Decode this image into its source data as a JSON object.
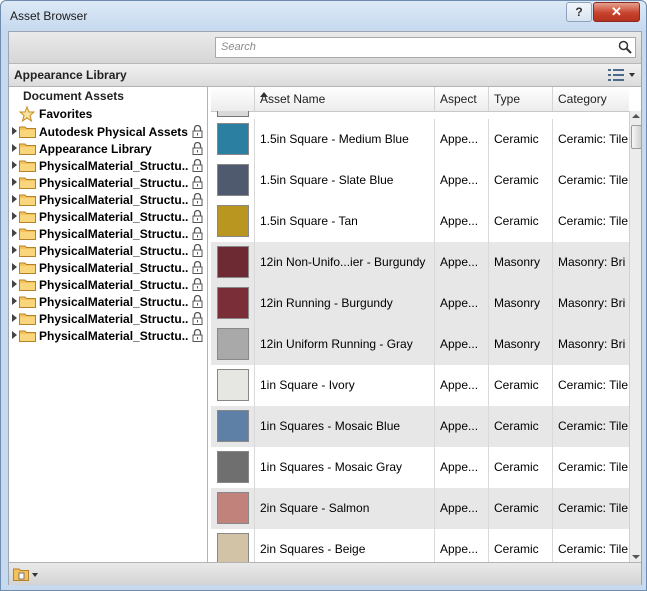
{
  "window": {
    "title": "Asset Browser",
    "help_label": "?",
    "close_label": "✕"
  },
  "search": {
    "placeholder": "Search"
  },
  "library_bar": {
    "title": "Appearance Library"
  },
  "tree": {
    "heading": "Document Assets",
    "favorites_label": "Favorites",
    "items": [
      {
        "label": "Autodesk Physical Assets"
      },
      {
        "label": "Appearance Library"
      },
      {
        "label": "PhysicalMaterial_Structu..."
      },
      {
        "label": "PhysicalMaterial_Structu..."
      },
      {
        "label": "PhysicalMaterial_Structu..."
      },
      {
        "label": "PhysicalMaterial_Structu..."
      },
      {
        "label": "PhysicalMaterial_Structu..."
      },
      {
        "label": "PhysicalMaterial_Structu..."
      },
      {
        "label": "PhysicalMaterial_Structu..."
      },
      {
        "label": "PhysicalMaterial_Structu..."
      },
      {
        "label": "PhysicalMaterial_Structu..."
      },
      {
        "label": "PhysicalMaterial_Structu..."
      },
      {
        "label": "PhysicalMaterial_Structu..."
      }
    ]
  },
  "table": {
    "columns": [
      "Asset Name",
      "Aspect",
      "Type",
      "Category"
    ],
    "sort_column": "Asset Name",
    "rows": [
      {
        "name": "1.5in Square - Medium Blue",
        "aspect": "Appe...",
        "type": "Ceramic",
        "category": "Ceramic: Tile",
        "color": "#2b7fa0"
      },
      {
        "name": "1.5in Square - Slate Blue",
        "aspect": "Appe...",
        "type": "Ceramic",
        "category": "Ceramic: Tile",
        "color": "#4f5a6e"
      },
      {
        "name": "1.5in Square - Tan",
        "aspect": "Appe...",
        "type": "Ceramic",
        "category": "Ceramic: Tile",
        "color": "#b9961f"
      },
      {
        "name": "12in Non-Unifo...ier - Burgundy",
        "aspect": "Appe...",
        "type": "Masonry",
        "category": "Masonry: Bri",
        "color": "#6e2a33"
      },
      {
        "name": "12in Running - Burgundy",
        "aspect": "Appe...",
        "type": "Masonry",
        "category": "Masonry: Bri",
        "color": "#7a2f38"
      },
      {
        "name": "12in Uniform Running - Gray",
        "aspect": "Appe...",
        "type": "Masonry",
        "category": "Masonry: Bri",
        "color": "#a9a9a9"
      },
      {
        "name": "1in Square - Ivory",
        "aspect": "Appe...",
        "type": "Ceramic",
        "category": "Ceramic: Tile",
        "color": "#e6e6e2"
      },
      {
        "name": "1in Squares - Mosaic Blue",
        "aspect": "Appe...",
        "type": "Ceramic",
        "category": "Ceramic: Tile",
        "color": "#5e7fa6"
      },
      {
        "name": "1in Squares - Mosaic Gray",
        "aspect": "Appe...",
        "type": "Ceramic",
        "category": "Ceramic: Tile",
        "color": "#6f6f6f"
      },
      {
        "name": "2in Square - Salmon",
        "aspect": "Appe...",
        "type": "Ceramic",
        "category": "Ceramic: Tile",
        "color": "#c0827b"
      },
      {
        "name": "2in Squares - Beige",
        "aspect": "Appe...",
        "type": "Ceramic",
        "category": "Ceramic: Tile",
        "color": "#d2c3a6"
      }
    ]
  }
}
